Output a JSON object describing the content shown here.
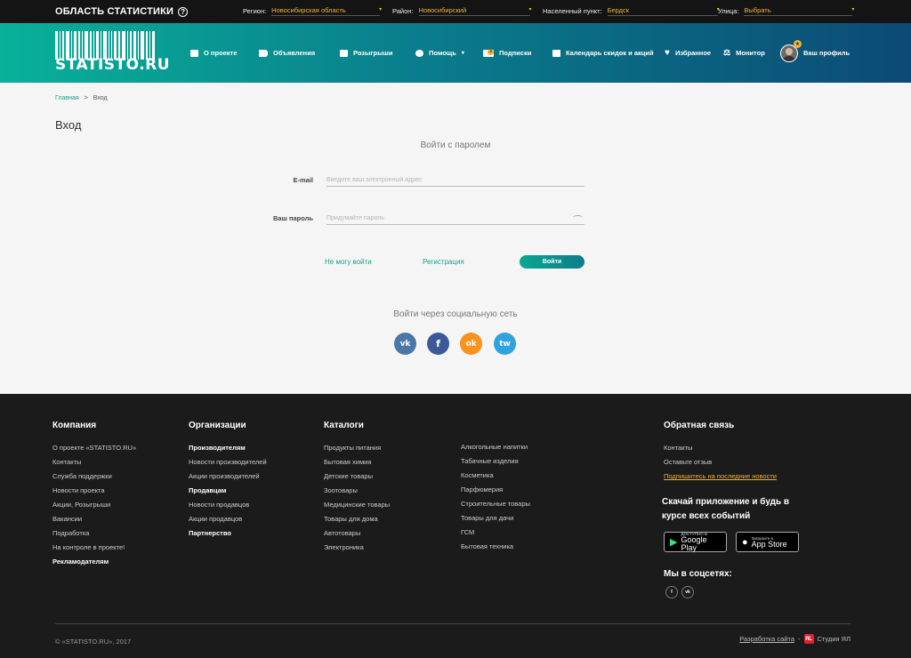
{
  "topbar": {
    "site_area": "ОБЛАСТЬ СТАТИСТИКИ",
    "region_label": "Регион:",
    "region_value": "Новосибирская область",
    "district_label": "Район:",
    "district_value": "Новосибирский",
    "locality_label": "Населенный пункт:",
    "locality_value": "Бердск",
    "street_label": "Улица:",
    "street_value": "Выбрать"
  },
  "header": {
    "logo_text": "STATISTO.RU",
    "nav": {
      "about": "О проекте",
      "ads": "Объявления",
      "draws": "Розыгрыши",
      "help": "Помощь",
      "subs": "Подписки",
      "subs_badge": "3",
      "calendar": "Календарь скидок и акций",
      "favorites": "Избранное",
      "monitor": "Монитор",
      "profile": "Ваш профиль"
    }
  },
  "breadcrumb": {
    "home": "Главная",
    "sep": ">",
    "current": "Вход"
  },
  "page_title": "Вход",
  "form": {
    "title": "Войти с паролем",
    "email_label": "E-mail",
    "email_placeholder": "Введите ваш электронный адрес",
    "password_label": "Ваш пароль",
    "password_placeholder": "Придумайте пароль",
    "cant_login": "Не могу войти",
    "register": "Регистрация",
    "submit": "Войти"
  },
  "social": {
    "title": "Войти через социальную сеть",
    "vk": "vk",
    "fb": "f",
    "ok": "ok",
    "tw": "tw",
    "colors": {
      "vk": "#4a76a8",
      "fb": "#3b5998",
      "ok": "#f7931e",
      "tw": "#2ea3de"
    }
  },
  "footer": {
    "company": {
      "title": "Компания",
      "items": [
        "О проекте «STATISTO.RU»",
        "Контакты",
        "Служба поддержки",
        "Новости проекта",
        "Акции, Розыгрыши",
        "Вакансии",
        "Подработка",
        "На контроле в проекте!",
        "Рекламодателям"
      ]
    },
    "orgs": {
      "title": "Организации",
      "items": [
        "Производителям",
        "Новости производителей",
        "Акции производителей",
        "Продавцам",
        "Новости продавцов",
        "Акции продавцов",
        "Партнерство"
      ]
    },
    "catalogs": {
      "title": "Каталоги",
      "col1": [
        "Продукты питания",
        "Бытовая химия",
        "Детские товары",
        "Зоотовары",
        "Медицинские товары",
        "Товары для дома",
        "Автотовары",
        "Электроника"
      ],
      "col2": [
        "Алкогольные напитки",
        "Табачные изделия",
        "Косметика",
        "Парфюмерия",
        "Строительные товары",
        "Товары для дачи",
        "ГСМ",
        "Бытовая техника"
      ]
    },
    "feedback": {
      "title": "Обратная связь",
      "items": [
        "Контакты",
        "Оставьте отзыв",
        "Подпишитесь на последние новости"
      ]
    },
    "app_title": "Скачай приложение и будь в курсе всех событий",
    "google": {
      "small": "ДОСТУПНО В",
      "big": "Google Play"
    },
    "apple": {
      "small": "Загрузите в",
      "big": "App Store"
    },
    "socials_title": "Мы в соцсетях:",
    "fb": "f",
    "vk": "vk",
    "copyright": "© «STATISTO.RU», 2017",
    "dev_link": "Разработка сайта",
    "dev_dash": "-",
    "dev_mark": "ЯL",
    "dev_studio": "Студия ЯЛ"
  }
}
